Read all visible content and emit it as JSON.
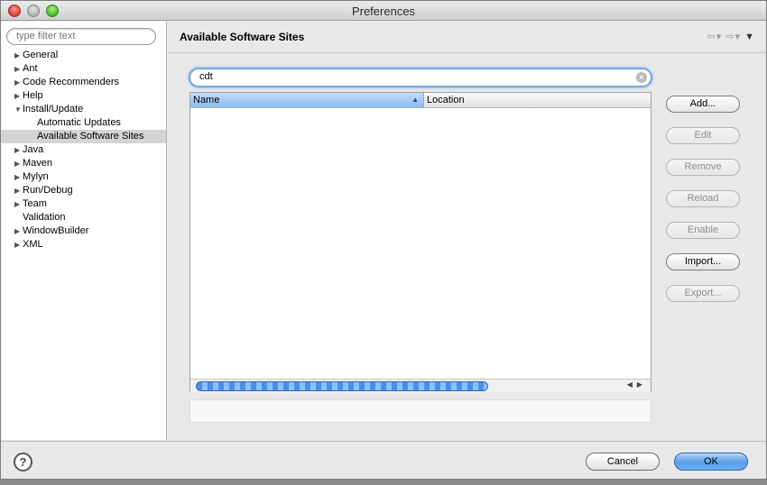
{
  "window": {
    "title": "Preferences"
  },
  "left": {
    "filter_placeholder": "type filter text",
    "tree": [
      {
        "label": "General",
        "expandable": true,
        "expanded": false,
        "depth": 0
      },
      {
        "label": "Ant",
        "expandable": true,
        "expanded": false,
        "depth": 0
      },
      {
        "label": "Code Recommenders",
        "expandable": true,
        "expanded": false,
        "depth": 0
      },
      {
        "label": "Help",
        "expandable": true,
        "expanded": false,
        "depth": 0
      },
      {
        "label": "Install/Update",
        "expandable": true,
        "expanded": true,
        "depth": 0
      },
      {
        "label": "Automatic Updates",
        "expandable": false,
        "depth": 1
      },
      {
        "label": "Available Software Sites",
        "expandable": false,
        "depth": 1,
        "selected": true
      },
      {
        "label": "Java",
        "expandable": true,
        "expanded": false,
        "depth": 0
      },
      {
        "label": "Maven",
        "expandable": true,
        "expanded": false,
        "depth": 0
      },
      {
        "label": "Mylyn",
        "expandable": true,
        "expanded": false,
        "depth": 0
      },
      {
        "label": "Run/Debug",
        "expandable": true,
        "expanded": false,
        "depth": 0
      },
      {
        "label": "Team",
        "expandable": true,
        "expanded": false,
        "depth": 0
      },
      {
        "label": "Validation",
        "expandable": false,
        "depth": 0
      },
      {
        "label": "WindowBuilder",
        "expandable": true,
        "expanded": false,
        "depth": 0
      },
      {
        "label": "XML",
        "expandable": true,
        "expanded": false,
        "depth": 0
      }
    ]
  },
  "main": {
    "title": "Available Software Sites",
    "search_value": "cdt",
    "columns": [
      {
        "label": "Name",
        "sorted": true
      },
      {
        "label": "Location"
      }
    ],
    "buttons": [
      {
        "label": "Add...",
        "enabled": true
      },
      {
        "label": "Edit",
        "enabled": false
      },
      {
        "label": "Remove",
        "enabled": false
      },
      {
        "label": "Reload",
        "enabled": false
      },
      {
        "label": "Enable",
        "enabled": false
      },
      {
        "label": "Import...",
        "enabled": true
      },
      {
        "label": "Export...",
        "enabled": false
      }
    ]
  },
  "footer": {
    "cancel_label": "Cancel",
    "ok_label": "OK"
  },
  "colors": {
    "accent": "#6fa7e8",
    "selection": "#d4d4d4",
    "ok_button": "#5a9ee8"
  }
}
